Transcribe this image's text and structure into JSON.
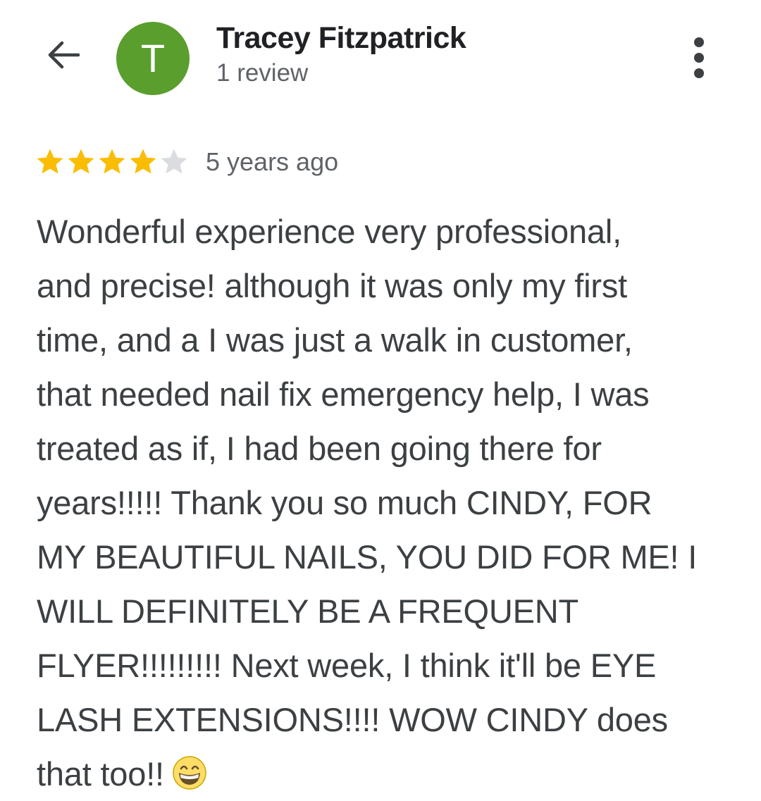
{
  "header": {
    "back_icon": "arrow-back-icon",
    "avatar_letter": "T",
    "avatar_color": "#5a9e2e",
    "reviewer_name": "Tracey Fitzpatrick",
    "review_count": "1 review",
    "more_icon": "more-vert-icon"
  },
  "rating": {
    "stars": 4,
    "max_stars": 5,
    "star_color": "#fbbc04",
    "empty_star_color": "#dadce0",
    "time_ago": "5 years ago"
  },
  "review": {
    "lines": [
      "Wonderful experience very professional,",
      "and precise! although it was only my first",
      "time, and a I was just a walk in customer,",
      "that needed nail fix emergency help, I was",
      "treated as if, I had been going there for",
      "years!!!!! Thank you so much CINDY, FOR",
      "MY BEAUTIFUL NAILS, YOU DID FOR ME! I",
      "WILL DEFINITELY BE A FREQUENT",
      "FLYER!!!!!!!!! Next week, I think it'll be EYE",
      "LASH EXTENSIONS!!!! WOW CINDY does",
      "that too!!"
    ],
    "emoji": "grinning-face-icon"
  }
}
